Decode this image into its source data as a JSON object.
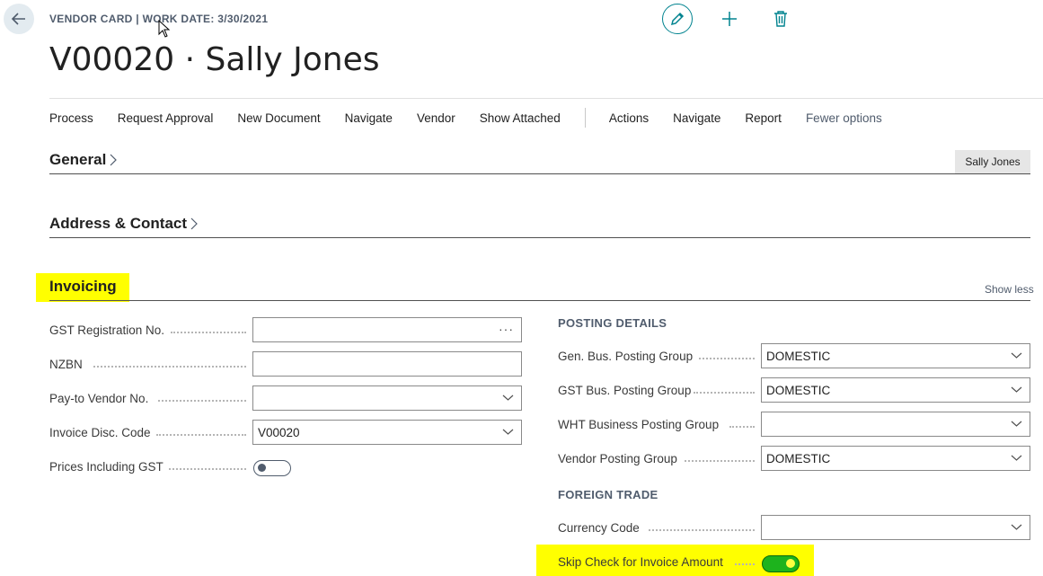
{
  "header": {
    "caption": "VENDOR CARD | WORK DATE: 3/30/2021",
    "title": "V00020 · Sally Jones"
  },
  "actions": {
    "primary": [
      "Process",
      "Request Approval",
      "New Document",
      "Navigate",
      "Vendor",
      "Show Attached"
    ],
    "secondary": [
      "Actions",
      "Navigate",
      "Report"
    ],
    "fewer_options": "Fewer options"
  },
  "sections": {
    "general": {
      "title": "General",
      "badge": "Sally Jones"
    },
    "address": {
      "title": "Address & Contact"
    },
    "invoicing": {
      "title": "Invoicing",
      "show_less": "Show less"
    }
  },
  "invoicing_left": {
    "gst_reg": {
      "label": "GST Registration No.",
      "value": ""
    },
    "nzbn": {
      "label": "NZBN",
      "value": ""
    },
    "pay_to": {
      "label": "Pay-to Vendor No.",
      "value": ""
    },
    "disc_code": {
      "label": "Invoice Disc. Code",
      "value": "V00020"
    },
    "prices_gst": {
      "label": "Prices Including GST",
      "checked": false
    }
  },
  "posting": {
    "heading": "POSTING DETAILS",
    "gen_bus": {
      "label": "Gen. Bus. Posting Group",
      "value": "DOMESTIC"
    },
    "gst_bus": {
      "label": "GST Bus. Posting Group",
      "value": "DOMESTIC"
    },
    "wht": {
      "label": "WHT Business Posting Group",
      "value": ""
    },
    "vendor_pg": {
      "label": "Vendor Posting Group",
      "value": "DOMESTIC"
    }
  },
  "foreign": {
    "heading": "FOREIGN TRADE",
    "currency": {
      "label": "Currency Code",
      "value": ""
    },
    "skip_check": {
      "label": "Skip Check for Invoice Amount",
      "checked": true
    }
  },
  "colors": {
    "accent": "#00838f",
    "highlight": "#ffff00",
    "toggle_on": "#1db31d"
  }
}
